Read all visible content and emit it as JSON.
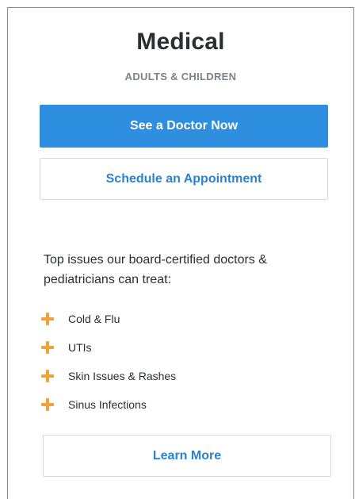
{
  "card": {
    "title": "Medical",
    "subtitle": "ADULTS & CHILDREN",
    "primary_button": "See a Doctor Now",
    "secondary_button": "Schedule an Appointment",
    "intro_text": "Top issues our board-certified doctors & pediatricians can treat:",
    "issues": [
      {
        "label": "Cold & Flu",
        "icon": "plus-icon"
      },
      {
        "label": "UTIs",
        "icon": "plus-icon"
      },
      {
        "label": "Skin Issues & Rashes",
        "icon": "plus-icon"
      },
      {
        "label": "Sinus Infections",
        "icon": "plus-icon"
      }
    ],
    "learn_more_button": "Learn More"
  },
  "colors": {
    "primary": "#2e8ee0",
    "link": "#2a83d0",
    "accent_plus": "#f2a23a",
    "text": "#2b2f33",
    "muted": "#7d8287"
  }
}
